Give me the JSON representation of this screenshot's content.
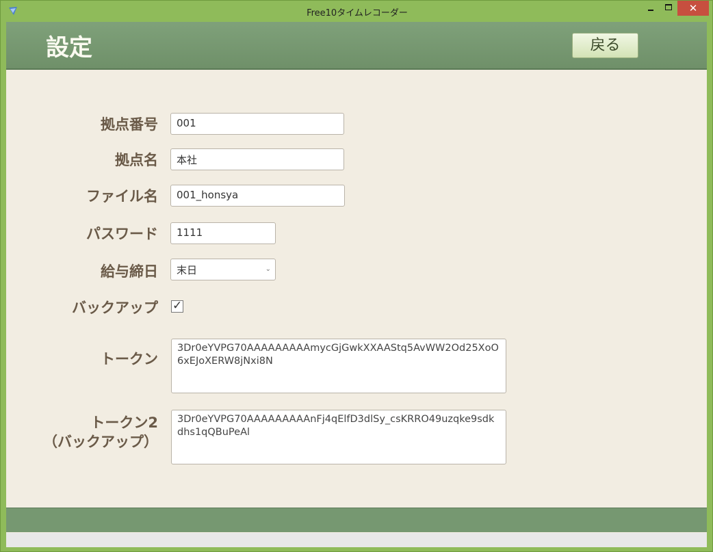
{
  "window": {
    "title": "Free10タイムレコーダー",
    "minimize_label": "",
    "close_label": "✕"
  },
  "header": {
    "title": "設定",
    "back_label": "戻る"
  },
  "form": {
    "branch_no": {
      "label": "拠点番号",
      "value": "001"
    },
    "branch_name": {
      "label": "拠点名",
      "value": "本社"
    },
    "file_name": {
      "label": "ファイル名",
      "value": "001_honsya"
    },
    "password": {
      "label": "パスワード",
      "value": "1111"
    },
    "payroll_cutoff": {
      "label": "給与締日",
      "value": "末日"
    },
    "backup": {
      "label": "バックアップ",
      "checked": true,
      "mark": "✓"
    },
    "token": {
      "label": "トークン",
      "value": "3Dr0eYVPG70AAAAAAAAAmycGjGwkXXAAStq5AvWW2Od25XoO6xEJoXERW8jNxi8N"
    },
    "token2": {
      "label_line1": "トークン2",
      "label_line2": "（バックアップ）",
      "value": "3Dr0eYVPG70AAAAAAAAAnFj4qElfD3dlSy_csKRRO49uzqke9sdkdhs1qQBuPeAl"
    }
  }
}
